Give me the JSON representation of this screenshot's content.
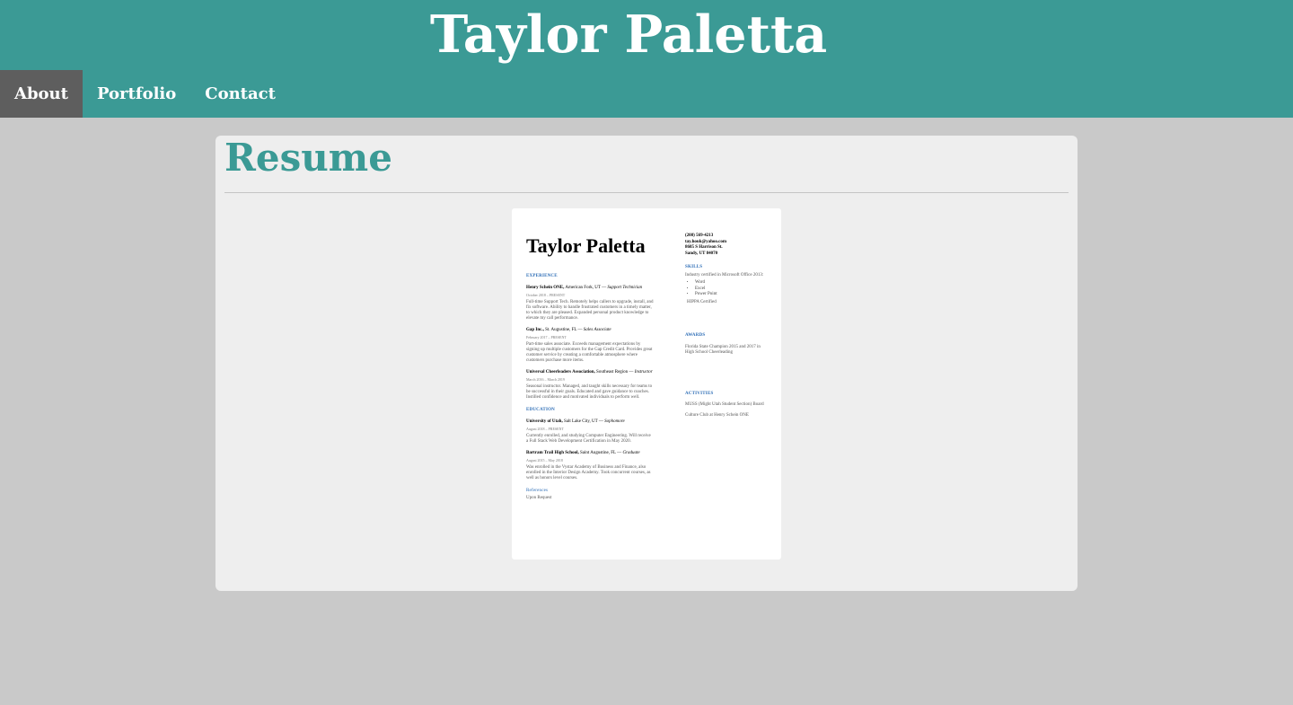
{
  "site": {
    "title": "Taylor Paletta"
  },
  "nav": [
    {
      "label": "About",
      "active": true
    },
    {
      "label": "Portfolio",
      "active": false
    },
    {
      "label": "Contact",
      "active": false
    }
  ],
  "card": {
    "title": "Resume"
  },
  "resume": {
    "name": "Taylor Paletta",
    "contact": [
      "(208) 569-4213",
      "tay.houk@yahoo.com",
      "8685 S Harrison St.",
      "Sandy, UT 84070"
    ],
    "experience_heading": "EXPERIENCE",
    "jobs": [
      {
        "org": "Henry Schein ONE,",
        "place": " American Fork, UT — ",
        "role": "Support Technician",
        "date": "October 2018 – PRESENT",
        "desc": "Full-time Support Tech. Remotely helps callers to upgrade, install, and fix software. Ability to handle frustrated customers in a timely matter, to which they are pleased. Expanded personal product knowledge to elevate my call performance."
      },
      {
        "org": "Gap Inc.,",
        "place": " St. Augustine, FL — ",
        "role": "Sales Associate",
        "date": "February 2017 – PRESENT",
        "desc": "Part-time sales associate. Exceeds management expectations by signing up multiple customers for the Gap Credit Card. Provides great customer service by creating a comfortable atmosphere where customers purchase more items."
      },
      {
        "org": "Universal Cheerleaders Association,",
        "place": " Southeast Region — ",
        "role": "Instructor",
        "date": "March 2016 – March 2019",
        "desc": "Seasonal instructor. Managed, and taught skills necessary for teams to be successful in their goals. Educated and gave guidance to coaches. Instilled confidence and motivated individuals to perform well."
      }
    ],
    "education_heading": "EDUCATION",
    "schools": [
      {
        "org": "University of Utah,",
        "place": " Salt Lake City, UT — ",
        "role": "Sophomore",
        "date": "August 2018 – PRESENT",
        "desc": "Currently enrolled, and studying Computer Engineering. Will receive a Full Stack Web Development Certification in May 2020."
      },
      {
        "org": "Bartram Trail High School,",
        "place": " Saint Augustine, FL — ",
        "role": "Graduate",
        "date": "August 2015 – May 2018",
        "desc": "Was enrolled in the Vystar Academy of Business and Finance, also enrolled in the Interior Design Academy. Took concurrent courses, as well as honors level courses."
      }
    ],
    "references_heading": "References",
    "references_text": "Upon Request",
    "skills_heading": "SKILLS",
    "skills_intro": "Industry certified in Microsoft Office 2013:",
    "skills": [
      "Word",
      "Excel",
      "Power Point"
    ],
    "skills_extra": "HIPPA Certified",
    "awards_heading": "AWARDS",
    "awards_text": "Florida State Champion 2015 and 2017 in High School Cheerleading",
    "activities_heading": "ACTIVITIES",
    "activities": [
      "MUSS (Might Utah Student Section) Board",
      "Culture Club at Henry Schein ONE"
    ]
  }
}
